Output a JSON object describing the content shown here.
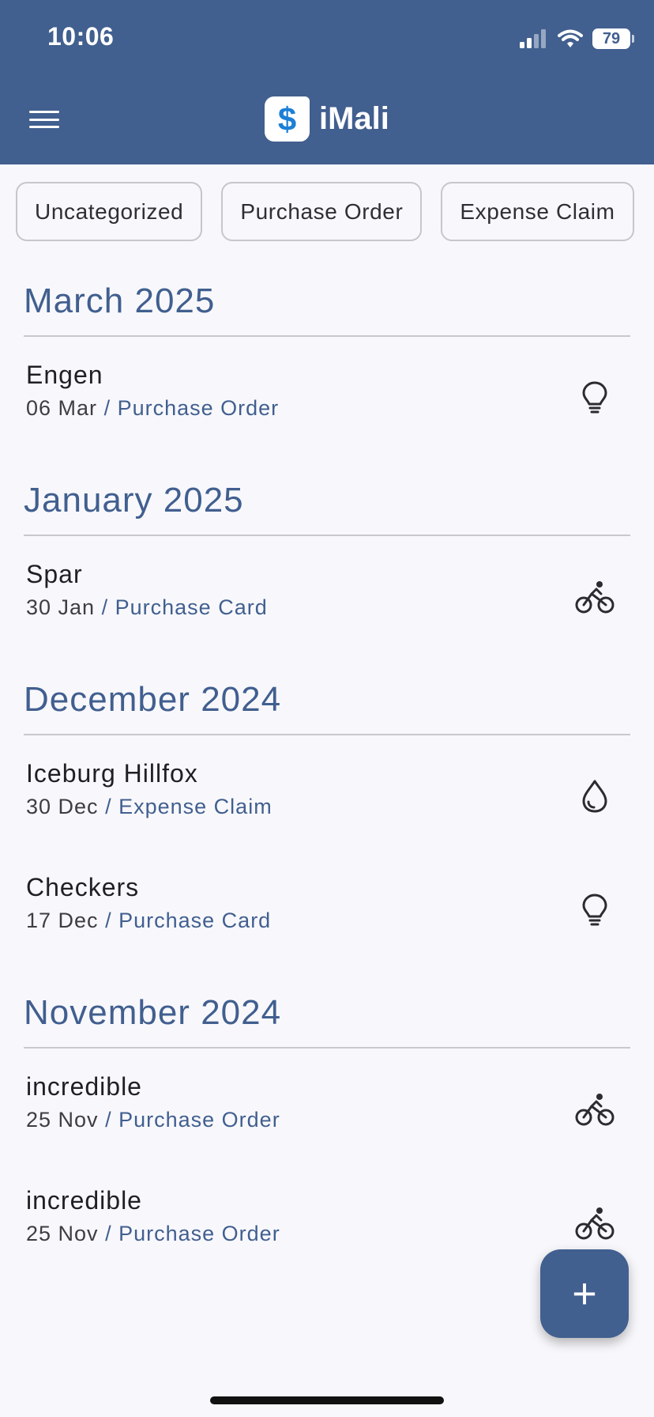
{
  "status_bar": {
    "time": "10:06",
    "battery": "79"
  },
  "header": {
    "app_title": "iMali",
    "logo_symbol": "$"
  },
  "filters": [
    "Uncategorized",
    "Purchase Order",
    "Expense Claim"
  ],
  "groups": [
    {
      "month": "March 2025",
      "items": [
        {
          "title": "Engen",
          "date": "06 Mar",
          "separator": "/",
          "category": "Purchase Order",
          "icon": "lightbulb-icon"
        }
      ]
    },
    {
      "month": "January 2025",
      "items": [
        {
          "title": "Spar",
          "date": "30 Jan",
          "separator": "/",
          "category": "Purchase Card",
          "icon": "bicycle-icon"
        }
      ]
    },
    {
      "month": "December 2024",
      "items": [
        {
          "title": "Iceburg Hillfox",
          "date": "30 Dec",
          "separator": "/",
          "category": "Expense Claim",
          "icon": "water-drop-icon"
        },
        {
          "title": "Checkers",
          "date": "17 Dec",
          "separator": "/",
          "category": "Purchase Card",
          "icon": "lightbulb-icon"
        }
      ]
    },
    {
      "month": "November 2024",
      "items": [
        {
          "title": "incredible",
          "date": "25 Nov",
          "separator": "/",
          "category": "Purchase Order",
          "icon": "bicycle-icon"
        },
        {
          "title": "incredible",
          "date": "25 Nov",
          "separator": "/",
          "category": "Purchase Order",
          "icon": "bicycle-icon"
        }
      ]
    }
  ],
  "fab": {
    "label": "+"
  },
  "colors": {
    "primary": "#415f8f",
    "background": "#f8f8fc",
    "logo_accent": "#1c7fd6"
  }
}
